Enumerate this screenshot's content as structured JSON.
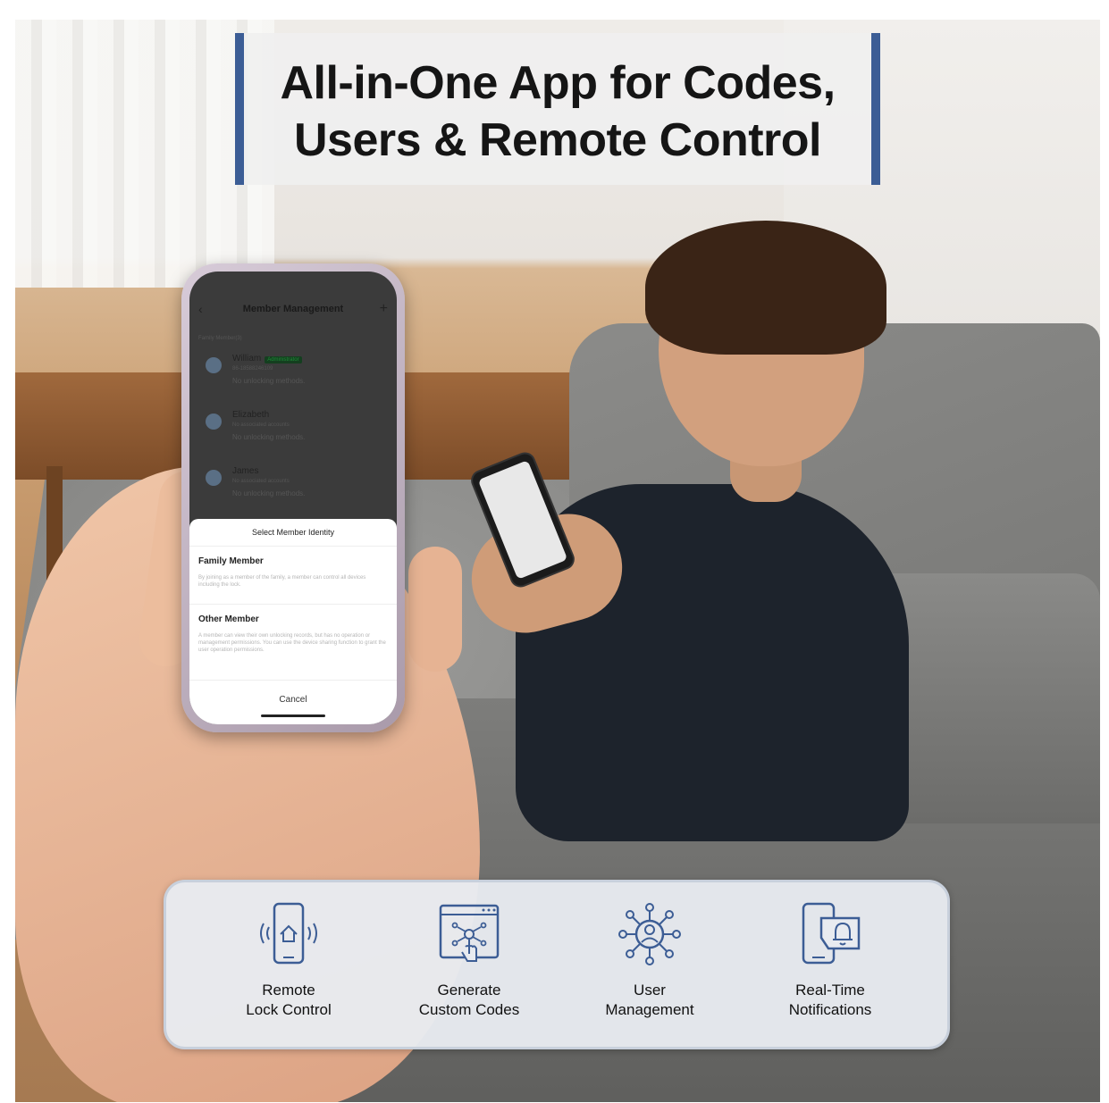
{
  "headline": {
    "line1": "All-in-One App for Codes,",
    "line2": "Users & Remote Control",
    "accent_color": "#3c5d95"
  },
  "phone_app": {
    "header_title": "Member Management",
    "back_icon": "chevron-left-icon",
    "add_icon": "plus-icon",
    "section_label": "Family Member(3)",
    "members": [
      {
        "name": "William",
        "badge": "Administrator",
        "sub": "86-18588246109",
        "note": "No unlocking methods."
      },
      {
        "name": "Elizabeth",
        "sub": "No associated accounts",
        "note": "No unlocking methods."
      },
      {
        "name": "James",
        "sub": "No associated accounts",
        "note": "No unlocking methods."
      }
    ],
    "sheet": {
      "title": "Select Member Identity",
      "options": [
        {
          "title": "Family Member",
          "description": "By joining as a member of the family, a member can control all devices including the lock."
        },
        {
          "title": "Other Member",
          "description": "A member can view their own unlocking records, but has no operation or management permissions. You can use the device sharing function to grant the user operation permissions."
        }
      ],
      "cancel_label": "Cancel"
    }
  },
  "features": [
    {
      "icon": "phone-home-remote-icon",
      "label": "Remote\nLock Control"
    },
    {
      "icon": "code-generate-icon",
      "label": "Generate\nCustom Codes"
    },
    {
      "icon": "user-network-icon",
      "label": "User\nManagement"
    },
    {
      "icon": "phone-bell-icon",
      "label": "Real-Time\nNotifications"
    }
  ],
  "icon_color": "#3c5d95"
}
